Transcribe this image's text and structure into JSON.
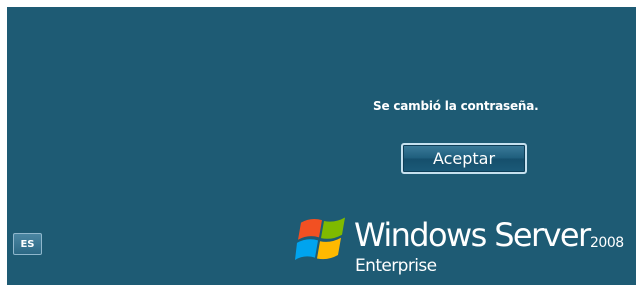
{
  "dialog": {
    "message": "Se cambió la contraseña.",
    "ok_label": "Aceptar"
  },
  "taskbar": {
    "language_label": "ES"
  },
  "branding": {
    "product": "Windows Server",
    "year": "2008",
    "edition": "Enterprise",
    "logo_icon": "windows-flag-icon"
  },
  "colors": {
    "background": "#1e5b74",
    "text": "#ffffff"
  }
}
